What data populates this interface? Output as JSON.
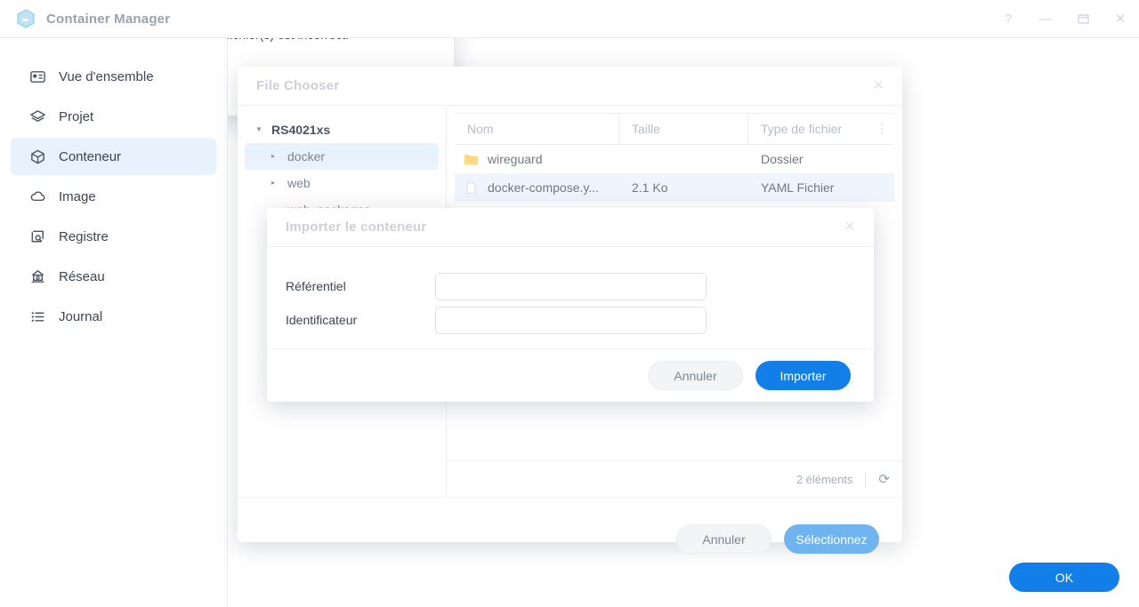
{
  "window": {
    "title": "Container Manager",
    "app_icon": "container-manager-icon",
    "controls": [
      {
        "name": "help-button",
        "glyph": "?"
      },
      {
        "name": "minimize-button",
        "glyph": "—"
      },
      {
        "name": "maximize-button",
        "glyph": "❑"
      },
      {
        "name": "close-button",
        "glyph": "✕"
      }
    ]
  },
  "sidebar": {
    "items": [
      {
        "label": "Vue d'ensemble",
        "icon": "overview-icon",
        "active": false
      },
      {
        "label": "Projet",
        "icon": "layers-icon",
        "active": false
      },
      {
        "label": "Conteneur",
        "icon": "cube-icon",
        "active": true
      },
      {
        "label": "Image",
        "icon": "cloud-icon",
        "active": false
      },
      {
        "label": "Registre",
        "icon": "registry-search-icon",
        "active": false
      },
      {
        "label": "Réseau",
        "icon": "network-icon",
        "active": false
      },
      {
        "label": "Journal",
        "icon": "list-icon",
        "active": false
      }
    ]
  },
  "file_chooser": {
    "title": "File Chooser",
    "close_glyph": "✕",
    "tree": {
      "root": {
        "label": "RS4021xs",
        "caret": "▼"
      },
      "nodes": [
        {
          "label": "docker",
          "caret": "▸",
          "selected": true
        },
        {
          "label": "web",
          "caret": "▸",
          "selected": false
        },
        {
          "label": "web_packages",
          "caret": "▸",
          "selected": false
        }
      ]
    },
    "table": {
      "columns": [
        "Nom",
        "Taille",
        "Type de fichier"
      ],
      "menu_glyph": "⋮",
      "rows": [
        {
          "name": "wireguard",
          "size": "",
          "type": "Dossier",
          "icon": "folder-icon",
          "selected": false
        },
        {
          "name": "docker-compose.y...",
          "size": "2.1 Ko",
          "type": "YAML Fichier",
          "icon": "file-icon",
          "selected": true
        }
      ]
    },
    "status": {
      "count": "2 éléments",
      "refresh_glyph": "⟳"
    },
    "buttons": {
      "cancel": "Annuler",
      "select": "Sélectionnez"
    }
  },
  "import_dialog": {
    "title": "Importer le conteneur",
    "close_glyph": "✕",
    "fields": [
      {
        "label": "Référentiel",
        "value": "",
        "placeholder": ""
      },
      {
        "label": "Identificateur",
        "value": "",
        "placeholder": ""
      }
    ],
    "buttons": {
      "cancel": "Annuler",
      "import": "Importer"
    }
  },
  "alert_dialog": {
    "message": "Le format de docker-compose.yaml fichier(s) est incorrect.",
    "ok": "OK"
  },
  "colors": {
    "accent": "#127fe8",
    "accent_light": "#70b4ef",
    "selection": "#e8f2fd",
    "text": "#3c4551",
    "muted": "#9aa2ad"
  }
}
